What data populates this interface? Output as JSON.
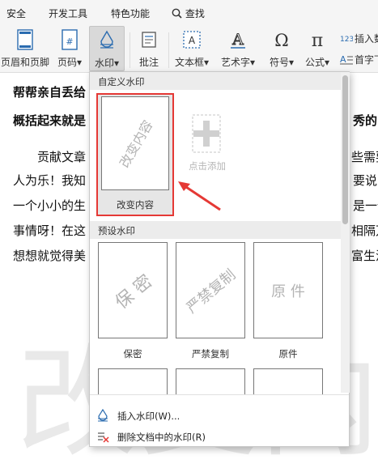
{
  "menu_tabs": [
    "安全",
    "开发工具",
    "特色功能",
    "查找"
  ],
  "ribbon": {
    "header_footer": "页眉和页脚",
    "page_number": "页码",
    "watermark": "水印",
    "annotation": "批注",
    "textbox": "文本框",
    "art_text": "艺术字",
    "symbol": "符号",
    "formula": "公式",
    "insert_number": "插入数",
    "first_char": "首字下"
  },
  "document": {
    "watermark_text": "改变内容",
    "lines": [
      "帮帮亲自丢给",
      "概括起来就是",
      "秀的",
      "贡献文章",
      "些需要",
      "人为乐！我知",
      "要说,",
      "一个小小的生",
      "是一件",
      "事情呀！在这",
      "相隔万",
      "想想就觉得美",
      "富生活"
    ]
  },
  "dropdown": {
    "custom_section": "自定义水印",
    "custom_item_text": "改变内容",
    "custom_item_label": "改变内容",
    "add_label": "点击添加",
    "preset_section": "预设水印",
    "presets": [
      {
        "text": "保 密",
        "label": "保密"
      },
      {
        "text": "严禁复制",
        "label": "严禁复制"
      },
      {
        "text": "原 件",
        "label": "原件"
      }
    ],
    "insert_watermark": "插入水印(W)...",
    "remove_watermark": "删除文档中的水印(R)"
  },
  "colors": {
    "highlight": "#e53935",
    "card_border": "#777777"
  },
  "icons": [
    "search-icon",
    "plus-icon",
    "watermark-icon",
    "remove-watermark-icon",
    "arrow-icon"
  ]
}
